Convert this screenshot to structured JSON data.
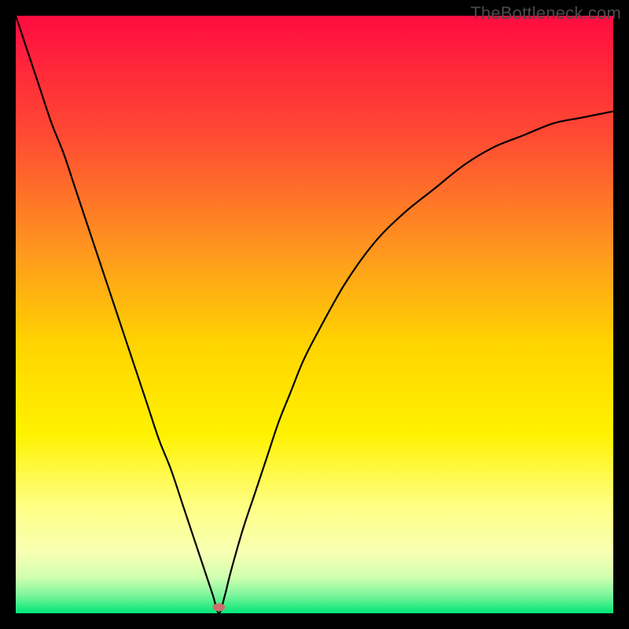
{
  "watermark": "TheBottleneck.com",
  "chart_data": {
    "type": "line",
    "title": "",
    "xlabel": "",
    "ylabel": "",
    "xlim": [
      0,
      1
    ],
    "ylim": [
      0,
      1
    ],
    "x_min_fraction": 0.34,
    "marker_y": 0.01,
    "gradient_stops": [
      {
        "offset": 0.0,
        "color": "#ff0c40"
      },
      {
        "offset": 0.2,
        "color": "#ff4a33"
      },
      {
        "offset": 0.4,
        "color": "#ff9a1e"
      },
      {
        "offset": 0.55,
        "color": "#ffd400"
      },
      {
        "offset": 0.7,
        "color": "#fff200"
      },
      {
        "offset": 0.82,
        "color": "#ffff84"
      },
      {
        "offset": 0.9,
        "color": "#f7ffb3"
      },
      {
        "offset": 0.94,
        "color": "#d0ffb0"
      },
      {
        "offset": 0.97,
        "color": "#7cf59c"
      },
      {
        "offset": 1.0,
        "color": "#00e676"
      }
    ],
    "series": [
      {
        "name": "bottleneck-curve",
        "x": [
          0.0,
          0.02,
          0.04,
          0.06,
          0.08,
          0.1,
          0.12,
          0.14,
          0.16,
          0.18,
          0.2,
          0.22,
          0.24,
          0.26,
          0.28,
          0.3,
          0.32,
          0.33,
          0.34,
          0.35,
          0.36,
          0.38,
          0.4,
          0.42,
          0.44,
          0.46,
          0.48,
          0.5,
          0.55,
          0.6,
          0.65,
          0.7,
          0.75,
          0.8,
          0.85,
          0.9,
          0.95,
          1.0
        ],
        "y": [
          1.0,
          0.94,
          0.88,
          0.82,
          0.77,
          0.71,
          0.65,
          0.59,
          0.53,
          0.47,
          0.41,
          0.35,
          0.29,
          0.24,
          0.18,
          0.12,
          0.06,
          0.03,
          0.0,
          0.03,
          0.07,
          0.14,
          0.2,
          0.26,
          0.32,
          0.37,
          0.42,
          0.46,
          0.55,
          0.62,
          0.67,
          0.71,
          0.75,
          0.78,
          0.8,
          0.82,
          0.83,
          0.84
        ]
      }
    ]
  }
}
